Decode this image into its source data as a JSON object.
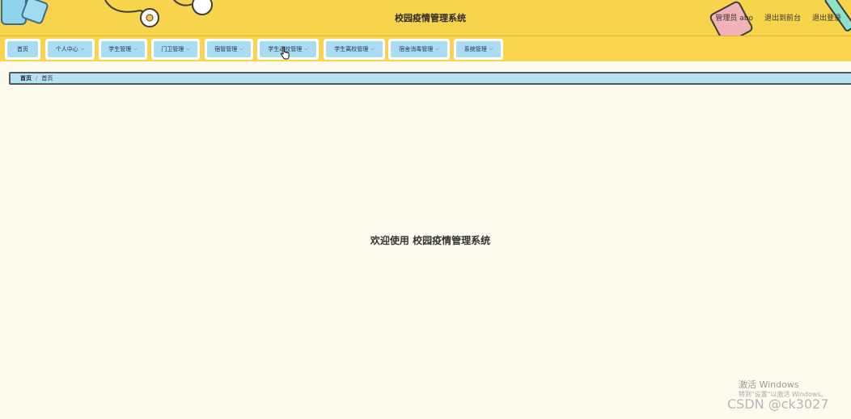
{
  "app": {
    "title": "校园疫情管理系统"
  },
  "user_bar": {
    "admin": "管理员 abo",
    "front": "退出到前台",
    "logout": "退出登录"
  },
  "nav": {
    "items": [
      {
        "label": "首页",
        "dropdown": false
      },
      {
        "label": "个人中心",
        "dropdown": true
      },
      {
        "label": "学生管理",
        "dropdown": true
      },
      {
        "label": "门卫管理",
        "dropdown": true
      },
      {
        "label": "宿管管理",
        "dropdown": true
      },
      {
        "label": "学生返校管理",
        "dropdown": true
      },
      {
        "label": "学生离校管理",
        "dropdown": true
      },
      {
        "label": "宿舍消毒管理",
        "dropdown": true
      },
      {
        "label": "系统管理",
        "dropdown": true
      }
    ]
  },
  "breadcrumb": {
    "home": "首页",
    "separator": "/",
    "current": "首页"
  },
  "main": {
    "welcome": "欢迎使用 校园疫情管理系统"
  },
  "watermark": {
    "activate_title": "激活 Windows",
    "activate_sub": "转到\"设置\"以激活 Windows。",
    "csdn": "CSDN @ck3027"
  },
  "colors": {
    "header_bg": "#f7d44c",
    "nav_item_bg": "#a9ddf4",
    "page_bg": "#fdfbee"
  },
  "icons": {
    "dropdown": "chevron-down-icon",
    "cursor": "hand-pointer-icon"
  }
}
